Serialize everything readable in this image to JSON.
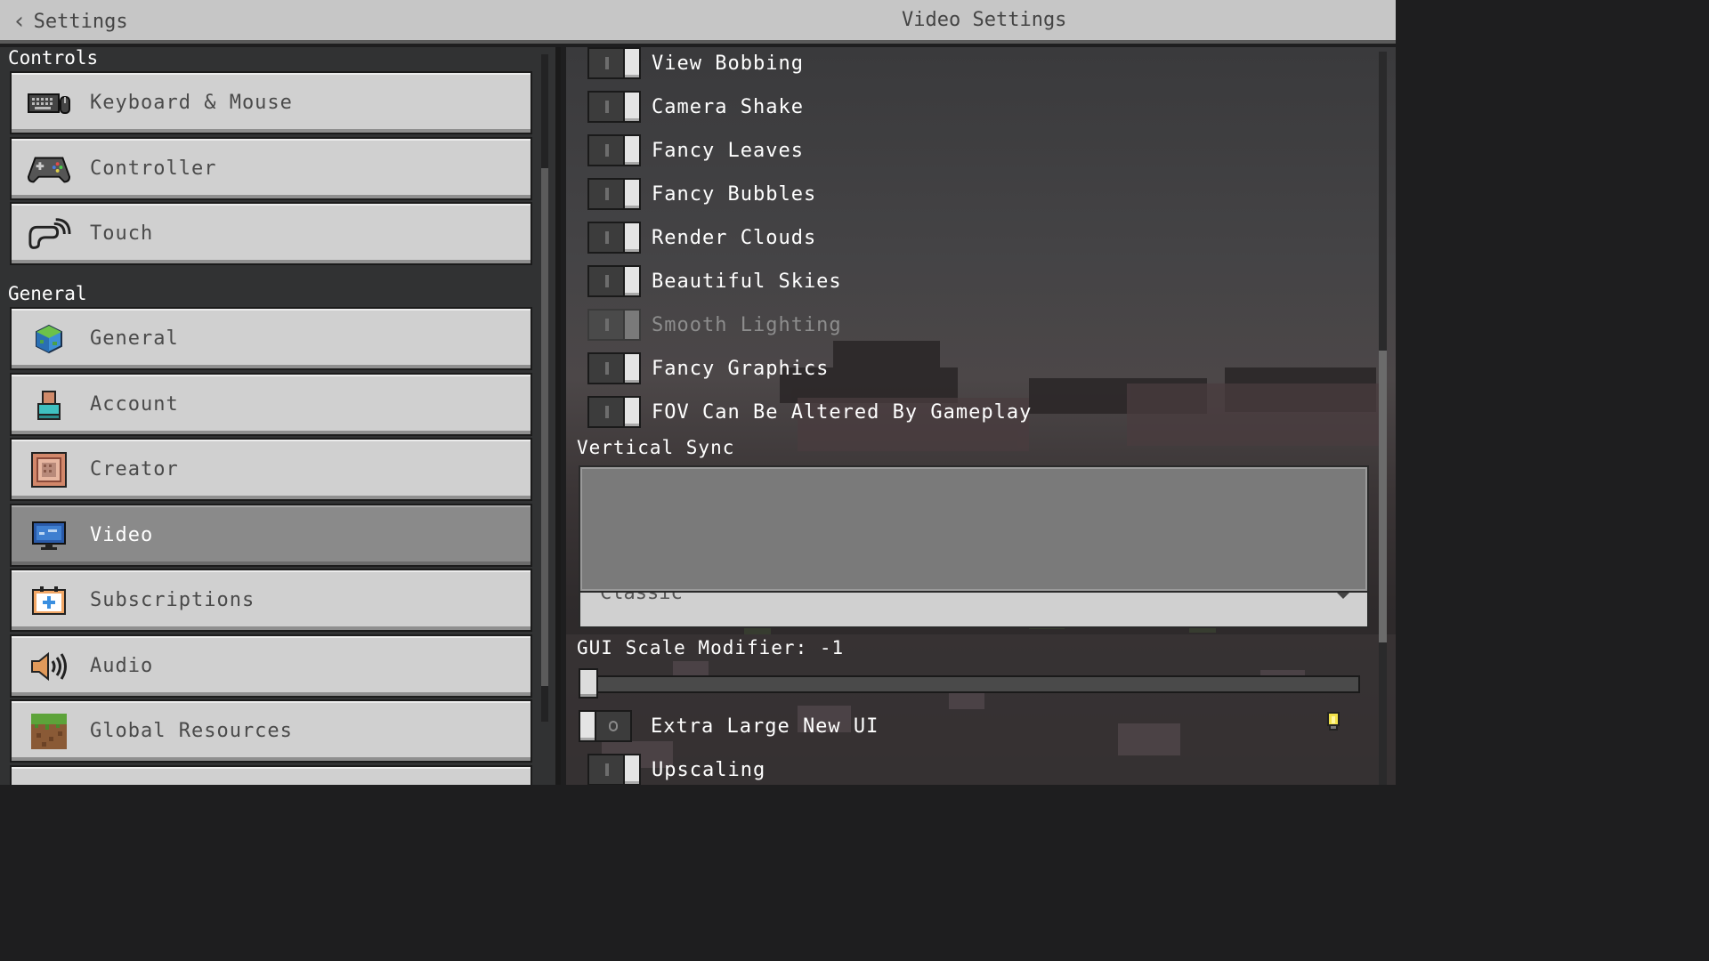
{
  "header": {
    "back_label": "Settings",
    "title": "Video Settings"
  },
  "sidebar": {
    "sections": [
      {
        "label": "Controls",
        "items": [
          {
            "label": "Keyboard & Mouse",
            "icon": "keyboard-mouse-icon"
          },
          {
            "label": "Controller",
            "icon": "gamepad-icon"
          },
          {
            "label": "Touch",
            "icon": "touch-hand-icon"
          }
        ]
      },
      {
        "label": "General",
        "items": [
          {
            "label": "General",
            "icon": "cube-globe-icon"
          },
          {
            "label": "Account",
            "icon": "account-person-icon"
          },
          {
            "label": "Creator",
            "icon": "creator-block-icon"
          },
          {
            "label": "Video",
            "icon": "monitor-icon",
            "active": true
          },
          {
            "label": "Subscriptions",
            "icon": "subscriptions-plus-icon"
          },
          {
            "label": "Audio",
            "icon": "speaker-icon"
          },
          {
            "label": "Global Resources",
            "icon": "grass-block-icon"
          }
        ]
      }
    ]
  },
  "video": {
    "toggles": [
      {
        "label": "View Bobbing",
        "on": false,
        "enabled": true
      },
      {
        "label": "Camera Shake",
        "on": false,
        "enabled": true
      },
      {
        "label": "Fancy Leaves",
        "on": false,
        "enabled": true
      },
      {
        "label": "Fancy Bubbles",
        "on": false,
        "enabled": true
      },
      {
        "label": "Render Clouds",
        "on": false,
        "enabled": true
      },
      {
        "label": "Beautiful Skies",
        "on": false,
        "enabled": true
      },
      {
        "label": "Smooth Lighting",
        "on": false,
        "enabled": false
      },
      {
        "label": "Fancy Graphics",
        "on": false,
        "enabled": true
      },
      {
        "label": "FOV Can Be Altered By Gameplay",
        "on": false,
        "enabled": true
      }
    ],
    "vertical_sync": {
      "label": "Vertical Sync",
      "selected": "Classic"
    },
    "gui_scale": {
      "label": "GUI Scale Modifier: -1",
      "value": -1
    },
    "extra_large_ui": {
      "label": "Extra Large New UI",
      "on": true
    },
    "upscaling": {
      "label": "Upscaling",
      "on": false
    }
  }
}
